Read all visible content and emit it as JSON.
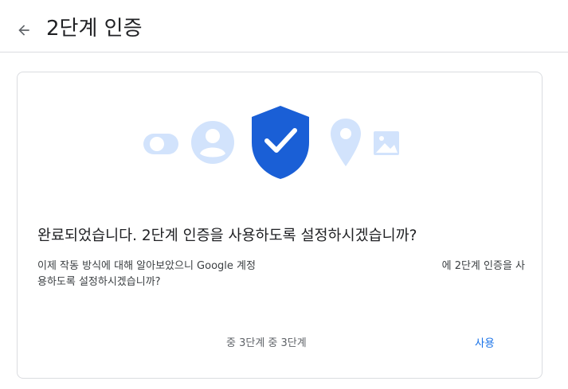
{
  "header": {
    "title": "2단계 인증",
    "back_icon": "arrow-back-icon"
  },
  "illustration": {
    "icons": [
      "toggle-icon",
      "account-icon",
      "shield-check-icon",
      "location-pin-icon",
      "image-icon"
    ],
    "colors": {
      "light_blue": "#d2e3fc",
      "shield_blue": "#1a5fd6",
      "check_white": "#ffffff"
    }
  },
  "card": {
    "heading": "완료되었습니다. 2단계 인증을 사용하도록 설정하시겠습니까?",
    "description_line1a": "이제 작동 방식에 대해 알아보았으니 Google 계정",
    "description_line1b": "에 2단계 인증을 사",
    "description_line2": "용하도록 설정하시겠습니까?",
    "step_indicator": "중 3단계 중 3단계",
    "use_button_label": "사용"
  },
  "colors": {
    "accent": "#1a73e8",
    "divider": "#dadce0",
    "text_primary": "#202124",
    "text_secondary": "#5f6368"
  }
}
